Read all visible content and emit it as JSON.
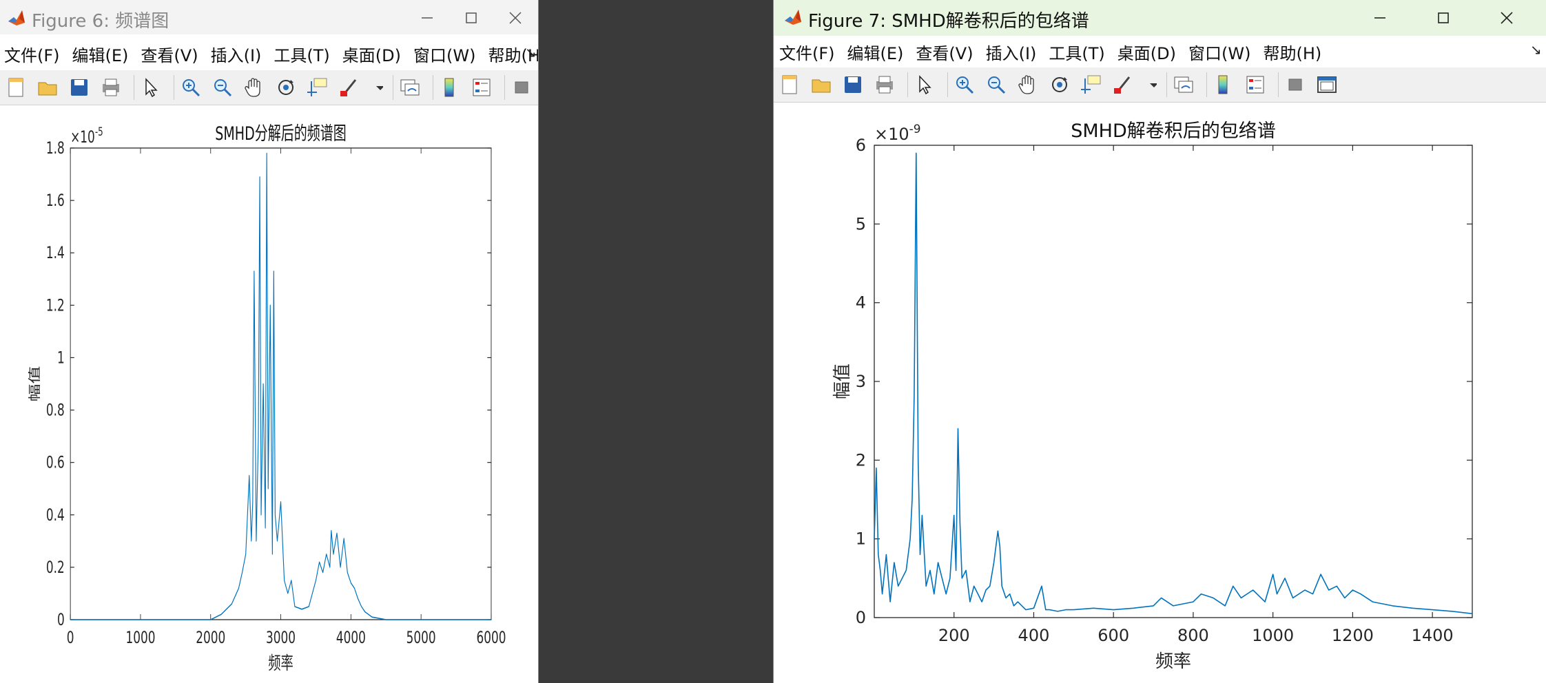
{
  "windows": [
    {
      "title": "Figure 6: 频谱图",
      "menu": [
        "文件(F)",
        "编辑(E)",
        "查看(V)",
        "插入(I)",
        "工具(T)",
        "桌面(D)",
        "窗口(W)",
        "帮助(H)"
      ],
      "dock_glyph": "↘",
      "chart_title": "SMHD分解后的频谱图",
      "xlabel": "频率",
      "ylabel": "幅值",
      "exponent_base": "×10",
      "exponent_power": "-5",
      "xticks": [
        "0",
        "1000",
        "2000",
        "3000",
        "4000",
        "5000",
        "6000"
      ],
      "yticks": [
        "0",
        "0.2",
        "0.4",
        "0.6",
        "0.8",
        "1",
        "1.2",
        "1.4",
        "1.6",
        "1.8"
      ]
    },
    {
      "title": "Figure 7: SMHD解卷积后的包络谱",
      "menu": [
        "文件(F)",
        "编辑(E)",
        "查看(V)",
        "插入(I)",
        "工具(T)",
        "桌面(D)",
        "窗口(W)",
        "帮助(H)"
      ],
      "dock_glyph": "↘",
      "chart_title": "SMHD解卷积后的包络谱",
      "xlabel": "频率",
      "ylabel": "幅值",
      "exponent_base": "×10",
      "exponent_power": "-9",
      "xticks": [
        "200",
        "400",
        "600",
        "800",
        "1000",
        "1200",
        "1400"
      ],
      "yticks": [
        "0",
        "1",
        "2",
        "3",
        "4",
        "5",
        "6"
      ]
    }
  ],
  "colors": {
    "line": "#0072BD",
    "titlebar_inactive": "#f3f3f3",
    "titlebar_active": "#e8f5e0"
  },
  "chart_data": [
    {
      "type": "line",
      "title": "SMHD分解后的频谱图",
      "xlabel": "频率",
      "ylabel": "幅值",
      "y_scale_multiplier": "1e-5",
      "xlim": [
        0,
        6000
      ],
      "ylim": [
        0,
        1.8
      ],
      "grid": false,
      "x": [
        0,
        2000,
        2150,
        2300,
        2400,
        2450,
        2500,
        2550,
        2580,
        2600,
        2620,
        2650,
        2680,
        2700,
        2720,
        2750,
        2780,
        2800,
        2820,
        2850,
        2880,
        2900,
        2920,
        2950,
        3000,
        3050,
        3100,
        3150,
        3200,
        3300,
        3400,
        3500,
        3550,
        3600,
        3650,
        3700,
        3720,
        3750,
        3800,
        3850,
        3900,
        3950,
        4000,
        4050,
        4100,
        4150,
        4200,
        4300,
        4500,
        6000
      ],
      "y": [
        0,
        0,
        0.02,
        0.06,
        0.12,
        0.18,
        0.25,
        0.55,
        0.3,
        0.45,
        1.33,
        0.3,
        0.7,
        1.69,
        0.4,
        0.9,
        0.35,
        1.78,
        0.5,
        1.2,
        0.25,
        1.33,
        0.4,
        0.3,
        0.45,
        0.15,
        0.1,
        0.15,
        0.05,
        0.04,
        0.05,
        0.15,
        0.22,
        0.18,
        0.25,
        0.2,
        0.34,
        0.25,
        0.33,
        0.2,
        0.31,
        0.18,
        0.14,
        0.12,
        0.08,
        0.05,
        0.03,
        0.01,
        0.0,
        0.0
      ]
    },
    {
      "type": "line",
      "title": "SMHD解卷积后的包络谱",
      "xlabel": "频率",
      "ylabel": "幅值",
      "y_scale_multiplier": "1e-9",
      "xlim": [
        0,
        1500
      ],
      "ylim": [
        0,
        6
      ],
      "grid": false,
      "x": [
        0,
        5,
        10,
        15,
        20,
        30,
        40,
        50,
        60,
        70,
        80,
        90,
        95,
        100,
        105,
        110,
        115,
        120,
        130,
        140,
        150,
        160,
        170,
        180,
        190,
        200,
        205,
        210,
        215,
        220,
        230,
        240,
        250,
        260,
        270,
        280,
        290,
        300,
        310,
        315,
        320,
        330,
        340,
        350,
        360,
        380,
        400,
        420,
        430,
        440,
        460,
        480,
        500,
        550,
        600,
        650,
        700,
        720,
        750,
        800,
        820,
        850,
        880,
        900,
        920,
        950,
        980,
        1000,
        1010,
        1030,
        1050,
        1080,
        1100,
        1120,
        1140,
        1160,
        1180,
        1200,
        1220,
        1250,
        1300,
        1350,
        1400,
        1450,
        1500
      ],
      "y": [
        1.0,
        1.9,
        0.8,
        0.6,
        0.3,
        0.8,
        0.2,
        0.7,
        0.4,
        0.5,
        0.6,
        1.0,
        1.5,
        2.8,
        5.9,
        2.0,
        0.8,
        1.3,
        0.4,
        0.6,
        0.3,
        0.7,
        0.5,
        0.3,
        0.5,
        1.3,
        0.6,
        2.4,
        1.2,
        0.5,
        0.6,
        0.2,
        0.4,
        0.3,
        0.2,
        0.35,
        0.4,
        0.7,
        1.1,
        0.9,
        0.4,
        0.25,
        0.3,
        0.15,
        0.2,
        0.1,
        0.12,
        0.4,
        0.1,
        0.1,
        0.08,
        0.1,
        0.1,
        0.12,
        0.1,
        0.12,
        0.15,
        0.25,
        0.15,
        0.2,
        0.3,
        0.25,
        0.15,
        0.4,
        0.25,
        0.35,
        0.2,
        0.55,
        0.3,
        0.5,
        0.25,
        0.35,
        0.3,
        0.55,
        0.35,
        0.4,
        0.25,
        0.35,
        0.3,
        0.2,
        0.15,
        0.12,
        0.1,
        0.08,
        0.05
      ]
    }
  ]
}
